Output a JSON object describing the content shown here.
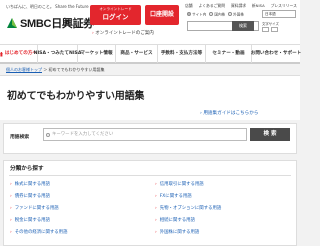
{
  "header": {
    "tagline": "いちばんに、明日のこと。 Share the Future",
    "logo_text": "SMBC日興証券",
    "login_small": "オンライントレード",
    "login_label": "ログイン",
    "open_account_label": "口座開設",
    "online_trade_link": "オンライントレードのご案内",
    "top_links": [
      "店舗",
      "よくあるご質問",
      "資料請求",
      "新NISA",
      "プレスリリース"
    ],
    "search_scopes": [
      "サイト内",
      "国内株",
      "外国株"
    ],
    "language_select": "日本語",
    "search_button": "検索",
    "font_size_label": "文字サイズ"
  },
  "nav": {
    "items": [
      "はじめての方へ",
      "NISA・つみたてNISA",
      "マーケット情報",
      "商品・サービス",
      "手数料・支払方法等",
      "セミナー・動画",
      "お問い合わせ・サポート"
    ]
  },
  "breadcrumb": {
    "home": "個人のお客様トップ",
    "current": "初めてでもわかりやすい用語集"
  },
  "page": {
    "title": "初めてでもわかりやすい用語集",
    "help_link": "用語集ガイドはこちらから"
  },
  "search": {
    "label": "用語検索",
    "placeholder": "キーワードを入力してください",
    "button": "検 索"
  },
  "categories": {
    "title": "分類から探す",
    "left": [
      "株式に関する用語",
      "債券に関する用語",
      "ファンドに関する用語",
      "税金に関する用語",
      "その他の経済に関する用語"
    ],
    "right": [
      "信用取引に関する用語",
      "FXに関する用語",
      "先物・オプションに関する用語",
      "相続に関する用語",
      "外国株に関する用語"
    ]
  },
  "colors": {
    "accent": "#e3262d",
    "link": "#1a5fb4",
    "background": "#f2f2f2"
  }
}
